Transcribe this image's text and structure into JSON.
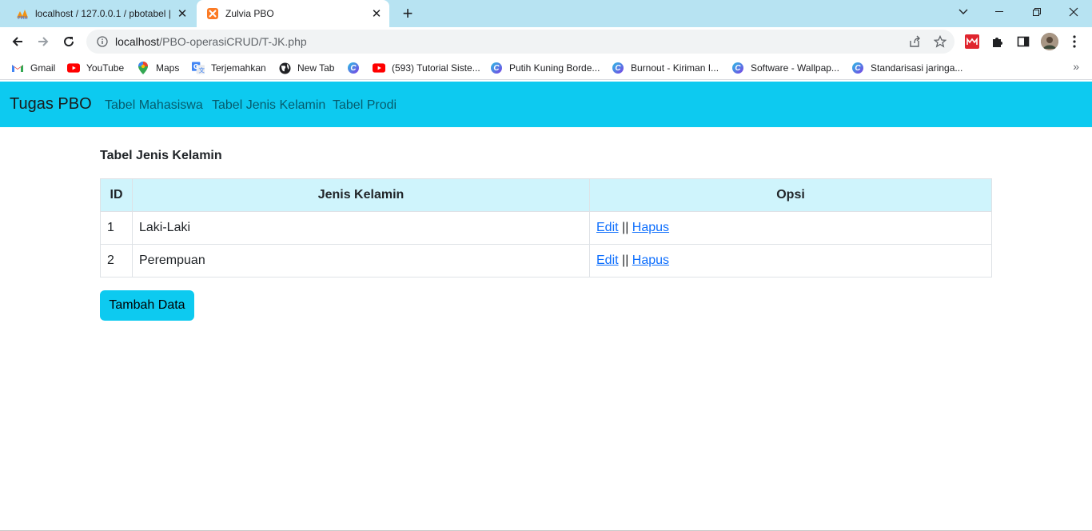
{
  "tabs": [
    {
      "title": "localhost / 127.0.0.1 / pbotabel |",
      "favicon": "phpmyadmin-icon"
    },
    {
      "title": "Zulvia PBO",
      "favicon": "xampp-icon"
    }
  ],
  "address_bar": {
    "host": "localhost",
    "path": "/PBO-operasiCRUD/T-JK.php"
  },
  "bookmarks": [
    {
      "label": "Gmail",
      "icon": "gmail-icon"
    },
    {
      "label": "YouTube",
      "icon": "youtube-icon"
    },
    {
      "label": "Maps",
      "icon": "maps-icon"
    },
    {
      "label": "Terjemahkan",
      "icon": "translate-icon"
    },
    {
      "label": "New Tab",
      "icon": "globe-icon"
    },
    {
      "label": "",
      "icon": "canva-icon"
    },
    {
      "label": "(593) Tutorial Siste...",
      "icon": "youtube-icon"
    },
    {
      "label": "Putih Kuning Borde...",
      "icon": "canva-icon"
    },
    {
      "label": "Burnout - Kiriman I...",
      "icon": "canva-icon"
    },
    {
      "label": "Software - Wallpap...",
      "icon": "canva-icon"
    },
    {
      "label": "Standarisasi jaringa...",
      "icon": "canva-icon"
    }
  ],
  "navbar": {
    "brand": "Tugas PBO",
    "links": [
      "Tabel Mahasiswa",
      "Tabel Jenis Kelamin",
      "Tabel Prodi"
    ]
  },
  "main": {
    "heading": "Tabel Jenis Kelamin",
    "table": {
      "headers": [
        "ID",
        "Jenis Kelamin",
        "Opsi"
      ],
      "rows": [
        {
          "id": "1",
          "jenis_kelamin": "Laki-Laki",
          "edit": "Edit",
          "separator": "||",
          "hapus": "Hapus"
        },
        {
          "id": "2",
          "jenis_kelamin": "Perempuan",
          "edit": "Edit",
          "separator": "||",
          "hapus": "Hapus"
        }
      ]
    },
    "add_button": "Tambah Data"
  },
  "colors": {
    "tab_strip": "#b7e3f2",
    "navbar": "#0dcaf0",
    "table_header": "#cff4fc",
    "link": "#0d6efd"
  }
}
